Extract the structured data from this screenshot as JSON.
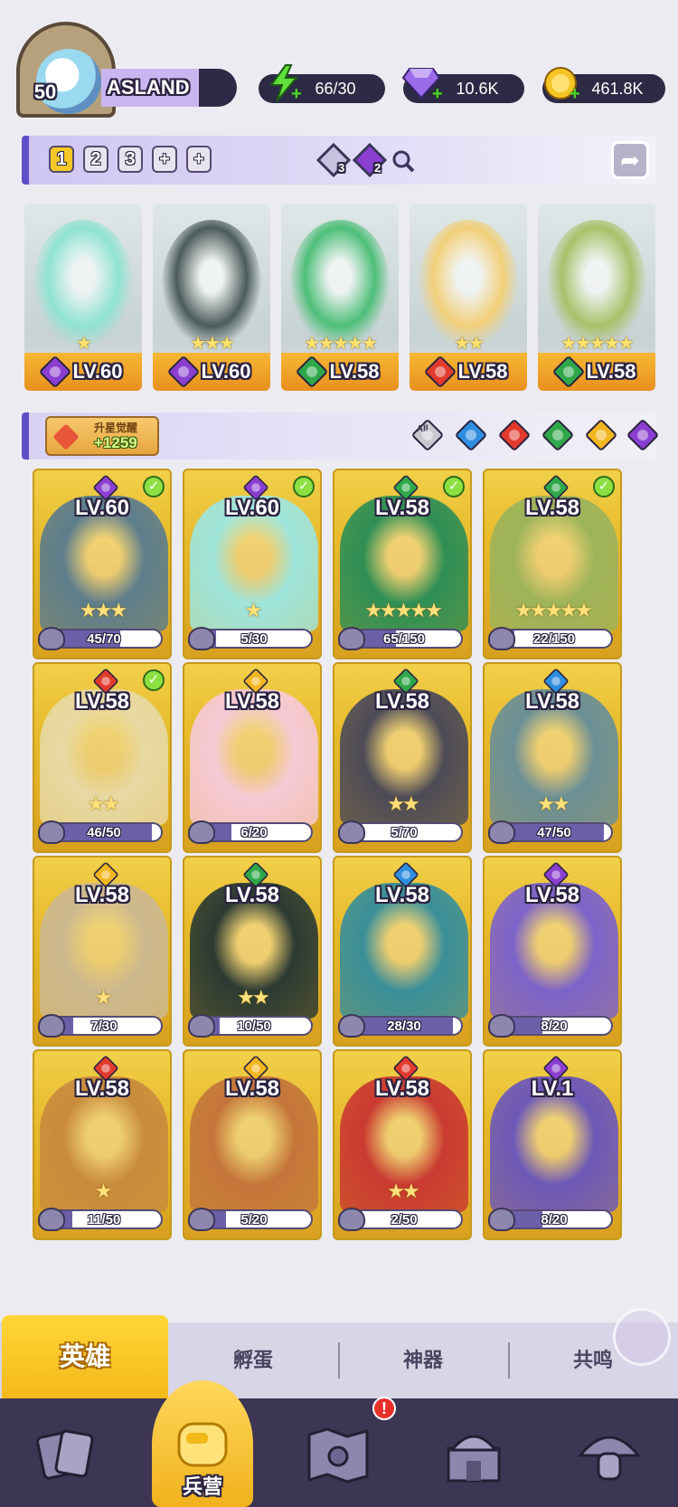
{
  "player": {
    "level": "50",
    "name": "ASLAND"
  },
  "resources": {
    "energy": "66/30",
    "gems": "10.6K",
    "coins": "461.8K"
  },
  "team_bar": {
    "slots": [
      "1",
      "2",
      "3",
      "+",
      "+"
    ],
    "active_slot": "1",
    "gem_a_count": "3",
    "gem_b_count": "2"
  },
  "lineup": [
    {
      "element": "dark",
      "level": "LV.60",
      "stars": "★",
      "art_color": "#8fe3d2"
    },
    {
      "element": "dark",
      "level": "LV.60",
      "stars": "★★★",
      "art_color": "#4c5b59"
    },
    {
      "element": "nature",
      "level": "LV.58",
      "stars": "★★★★★",
      "art_color": "#4dbf78"
    },
    {
      "element": "fire",
      "level": "LV.58",
      "stars": "★★",
      "art_color": "#f2d07a"
    },
    {
      "element": "nature",
      "level": "LV.58",
      "stars": "★★★★★",
      "art_color": "#a7c26a"
    }
  ],
  "awaken": {
    "title": "升星觉醒",
    "count": "+1259"
  },
  "filters": {
    "all_label": "All",
    "elements": [
      "all",
      "water",
      "fire",
      "nature",
      "light",
      "dark"
    ]
  },
  "heroes": [
    {
      "element": "dark",
      "level": "LV.60",
      "checked": true,
      "stars": "★★★",
      "shards": "45/70",
      "progress": 0.64,
      "art_color": "#5d7d8c"
    },
    {
      "element": "dark",
      "level": "LV.60",
      "checked": true,
      "stars": "★",
      "shards": "5/30",
      "progress": 0.17,
      "art_color": "#9fe5dc"
    },
    {
      "element": "nature",
      "level": "LV.58",
      "checked": true,
      "stars": "★★★★★",
      "shards": "65/150",
      "progress": 0.43,
      "art_color": "#2f8f55"
    },
    {
      "element": "nature",
      "level": "LV.58",
      "checked": true,
      "stars": "★★★★★",
      "shards": "22/150",
      "progress": 0.15,
      "art_color": "#9db35a"
    },
    {
      "element": "fire",
      "level": "LV.58",
      "checked": true,
      "stars": "★★",
      "shards": "46/50",
      "progress": 0.92,
      "art_color": "#e8d9a3"
    },
    {
      "element": "light",
      "level": "LV.58",
      "checked": false,
      "stars": "",
      "shards": "6/20",
      "progress": 0.3,
      "art_color": "#f6c9d6"
    },
    {
      "element": "nature",
      "level": "LV.58",
      "checked": false,
      "stars": "★★",
      "shards": "5/70",
      "progress": 0.07,
      "art_color": "#4d4b57"
    },
    {
      "element": "water",
      "level": "LV.58",
      "checked": false,
      "stars": "★★",
      "shards": "47/50",
      "progress": 0.94,
      "art_color": "#6b8f96"
    },
    {
      "element": "light",
      "level": "LV.58",
      "checked": false,
      "stars": "★",
      "shards": "7/30",
      "progress": 0.23,
      "art_color": "#cdb88f"
    },
    {
      "element": "nature",
      "level": "LV.58",
      "checked": false,
      "stars": "★★",
      "shards": "10/50",
      "progress": 0.2,
      "art_color": "#2b3a33"
    },
    {
      "element": "water",
      "level": "LV.58",
      "checked": false,
      "stars": "",
      "shards": "28/30",
      "progress": 0.93,
      "art_color": "#3a8f99"
    },
    {
      "element": "dark",
      "level": "LV.58",
      "checked": false,
      "stars": "",
      "shards": "8/20",
      "progress": 0.4,
      "art_color": "#7d63c9"
    },
    {
      "element": "fire",
      "level": "LV.58",
      "checked": false,
      "stars": "★",
      "shards": "11/50",
      "progress": 0.22,
      "art_color": "#c98b3d"
    },
    {
      "element": "light",
      "level": "LV.58",
      "checked": false,
      "stars": "",
      "shards": "5/20",
      "progress": 0.25,
      "art_color": "#c4763a"
    },
    {
      "element": "fire",
      "level": "LV.58",
      "checked": false,
      "stars": "★★",
      "shards": "2/50",
      "progress": 0.04,
      "art_color": "#c93a30"
    },
    {
      "element": "dark",
      "level": "LV.1",
      "checked": false,
      "stars": "",
      "shards": "8/20",
      "progress": 0.4,
      "art_color": "#6d58b8"
    }
  ],
  "section_tabs": {
    "active": "英雄",
    "items": [
      "孵蛋",
      "神器",
      "共鸣"
    ]
  },
  "nav": {
    "active_label": "兵营",
    "alert_badge": "!"
  },
  "colors": {
    "accent": "#5f4fc7",
    "gold": "#f3b81a",
    "dark_panel": "#2d2a45",
    "nav_bg": "#3c3553"
  }
}
